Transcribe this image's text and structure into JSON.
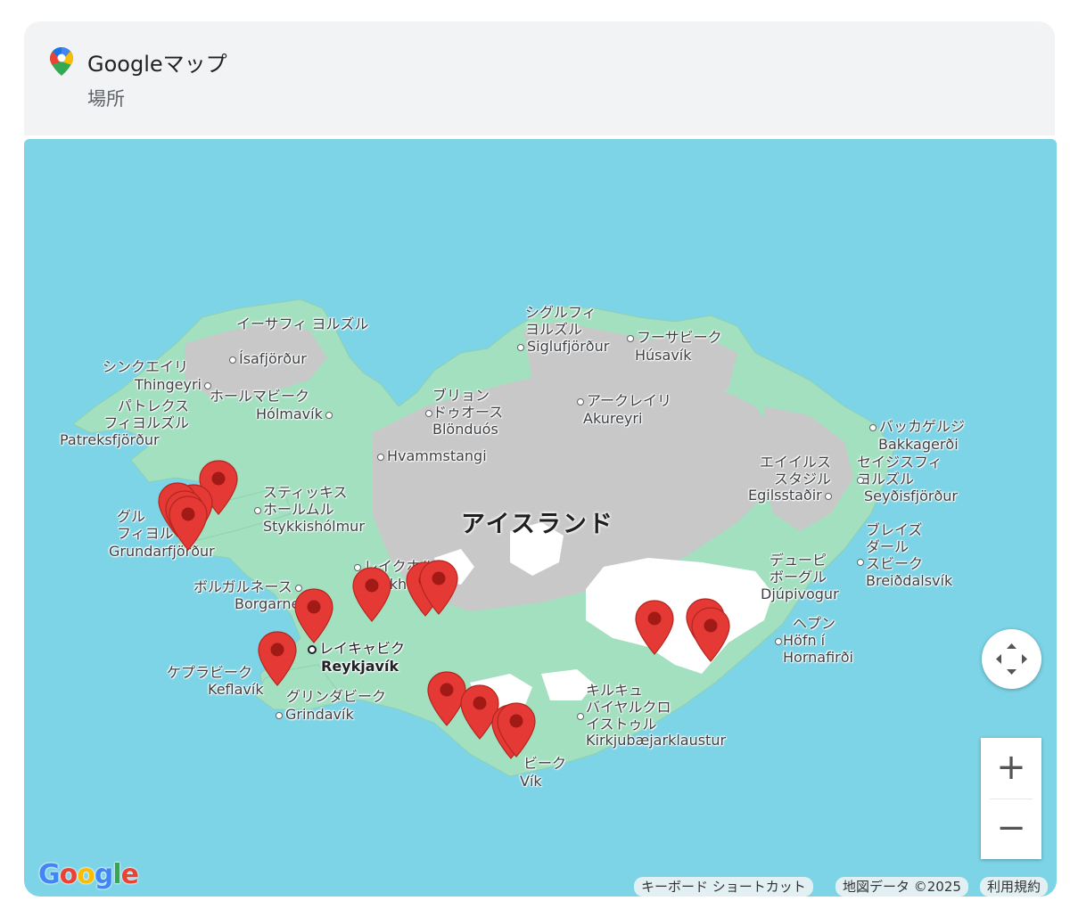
{
  "header": {
    "title": "Googleマップ",
    "subtitle": "場所"
  },
  "map": {
    "country_label": "アイスランド",
    "places": [
      {
        "ja": "イーサフィ\nヨルズル",
        "en": "Ísafjörður"
      },
      {
        "ja": "シンクエイリ",
        "en": "Thingeyri"
      },
      {
        "ja": "パトレクス\nフィヨルズル",
        "en": "Patreksfjörður"
      },
      {
        "ja": "ホールマビーク",
        "en": "Hólmavík"
      },
      {
        "ja": "シグルフィ\nヨルズル",
        "en": "Siglufjörður"
      },
      {
        "ja": "フーサビーク",
        "en": "Húsavík"
      },
      {
        "ja": "ブリョン\nドゥオース",
        "en": "Blönduós"
      },
      {
        "ja": "アークレイリ",
        "en": "Akureyri"
      },
      {
        "ja": "",
        "en": "Hvammstangi"
      },
      {
        "ja": "バッカゲルジ",
        "en": "Bakkagerði"
      },
      {
        "ja": "エイイルス\nスタジル",
        "en": "Egilsstaðir"
      },
      {
        "ja": "セイジスフィ\nヨルズル",
        "en": "Seyðisfjörður"
      },
      {
        "ja": "スティッキス\nホールムル",
        "en": "Stykkishólmur"
      },
      {
        "ja": "グル\nフィヨル",
        "en": "Grundarfjörður"
      },
      {
        "ja": "レイクホルト",
        "en": "Reykholt"
      },
      {
        "ja": "ボルガルネース",
        "en": "Borgarnes"
      },
      {
        "ja": "デューピ\nボーグル",
        "en": "Djúpivogur"
      },
      {
        "ja": "ブレイズ\nダール\nスビーク",
        "en": "Breiðdalsvík"
      },
      {
        "ja": "ヘプン",
        "en": "Höfn í\nHornafirði"
      },
      {
        "ja": "レイキャビク",
        "en": "Reykjavík"
      },
      {
        "ja": "ケプラビーク",
        "en": "Keflavík"
      },
      {
        "ja": "グリンダビーク",
        "en": "Grindavík"
      },
      {
        "ja": "キルキュ\nバイヤルクロ\nイストゥル",
        "en": "Kirkjubæjarklaustur"
      },
      {
        "ja": "ビーク",
        "en": "Vík"
      }
    ],
    "marker_count": 17,
    "marker_color": "#e53935",
    "controls": {
      "zoom_in": "+",
      "zoom_out": "−"
    },
    "google_logo": "Google",
    "attribution": {
      "shortcuts": "キーボード ショートカット",
      "map_data": "地図データ ©2025",
      "terms": "利用規約"
    }
  },
  "colors": {
    "water": "#7cd4e6",
    "land_green": "#a3e0c0",
    "highland_gray": "#c8c8c8",
    "glacier": "#ffffff",
    "marker": "#e53935"
  }
}
